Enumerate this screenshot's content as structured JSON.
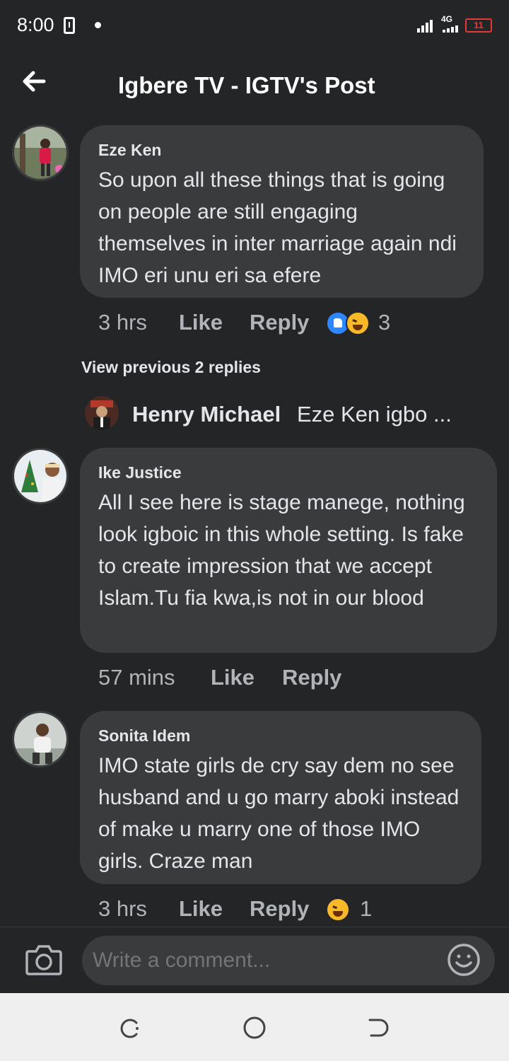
{
  "status_bar": {
    "time": "8:00",
    "network": "4G",
    "battery": "11"
  },
  "header": {
    "title": "Igbere TV - IGTV's Post"
  },
  "comments": [
    {
      "author": "Eze Ken",
      "text": "So upon all these things that is going on people are still engaging themselves in inter marriage again ndi IMO eri unu eri sa efere",
      "time": "3 hrs",
      "like_label": "Like",
      "reply_label": "Reply",
      "reactions": [
        "like",
        "haha"
      ],
      "reaction_count": "3"
    },
    {
      "author": "Ike Justice",
      "text": "All I see here is stage manege, nothing look igboic in this whole setting. Is fake to create impression that we accept Islam.Tu fia kwa,is not in our blood",
      "time": "57 mins",
      "like_label": "Like",
      "reply_label": "Reply"
    },
    {
      "author": "Sonita Idem",
      "text": "IMO state girls de cry say dem no see husband and u go marry aboki instead of make u marry one of those IMO girls. Craze man",
      "time": "3 hrs",
      "like_label": "Like",
      "reply_label": "Reply",
      "reactions": [
        "haha"
      ],
      "reaction_count": "1"
    }
  ],
  "replies": {
    "view_previous_label": "View previous 2 replies",
    "latest_author": "Henry Michael",
    "latest_snippet": "Eze Ken igbo ..."
  },
  "composer": {
    "placeholder": "Write a comment..."
  },
  "colors": {
    "background": "#242526",
    "bubble": "#3a3b3c",
    "text": "#e4e6eb",
    "secondary_text": "#b0b3b8",
    "like_blue": "#2d88ff",
    "haha_yellow": "#f7b928",
    "battery_red": "#e53935"
  },
  "icons": [
    "back-arrow-icon",
    "camera-icon",
    "emoji-icon",
    "recents-icon",
    "home-icon",
    "back-nav-icon",
    "like-reaction-icon",
    "haha-reaction-icon"
  ]
}
